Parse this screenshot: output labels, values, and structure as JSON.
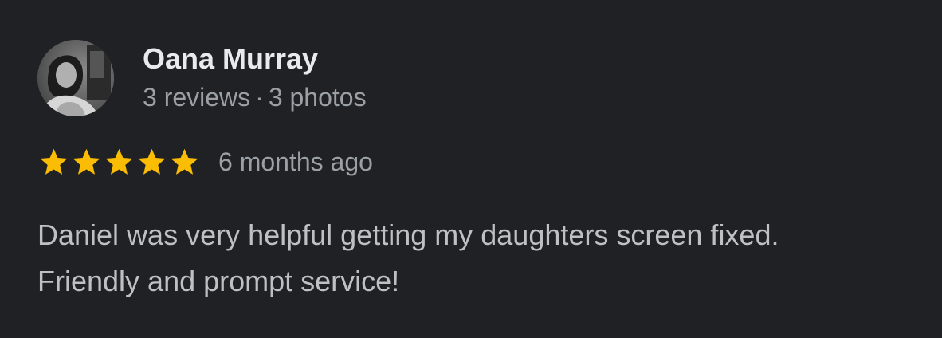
{
  "author": {
    "name": "Oana Murray",
    "reviews_count": "3 reviews",
    "separator": "·",
    "photos_count": "3 photos",
    "avatar_icon": "profile-photo-avatar"
  },
  "rating": {
    "stars": 5,
    "max_stars": 5,
    "star_color": "#fbbc04",
    "star_icon": "star-icon",
    "age": "6 months ago"
  },
  "review": {
    "line1": "Daniel was very helpful getting my daughters screen fixed.",
    "line2": "Friendly and prompt service!"
  },
  "colors": {
    "background": "#202124",
    "name": "#e8eaed",
    "meta": "#9aa0a6",
    "body": "#bdc1c6"
  }
}
